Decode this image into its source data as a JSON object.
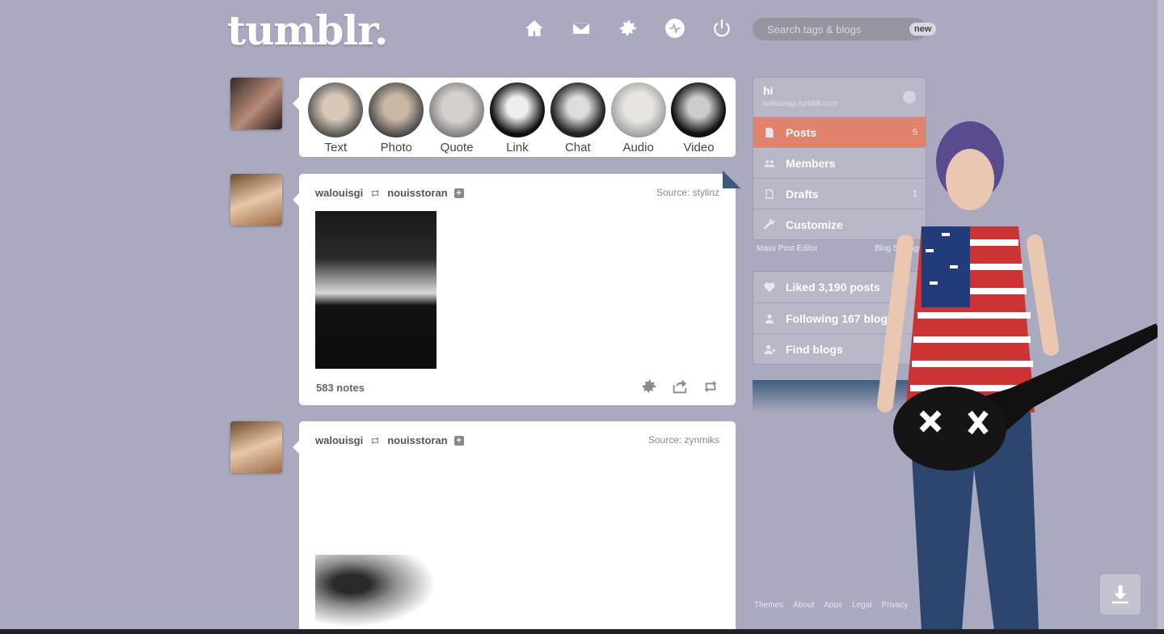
{
  "header": {
    "logo": "tumblr.",
    "nav": [
      "home-icon",
      "mail-icon",
      "gear-icon",
      "activity-icon",
      "power-icon"
    ],
    "search_placeholder": "Search tags & blogs",
    "search_badge": "new"
  },
  "post_types": [
    "Text",
    "Photo",
    "Quote",
    "Link",
    "Chat",
    "Audio",
    "Video"
  ],
  "posts": [
    {
      "user": "walouisgi",
      "reblogged_from": "nouisstoran",
      "source": "Source: stylinz",
      "notes": "583 notes"
    },
    {
      "user": "walouisgi",
      "reblogged_from": "nouisstoran",
      "source": "Source: zynmiks"
    }
  ],
  "sidebar": {
    "blog_title": "hi",
    "blog_url": "walouisgi.tumblr.com",
    "items": [
      {
        "label": "Posts",
        "count": "5",
        "icon": "posts-icon"
      },
      {
        "label": "Members",
        "count": "",
        "icon": "members-icon"
      },
      {
        "label": "Drafts",
        "count": "1",
        "icon": "drafts-icon"
      },
      {
        "label": "Customize",
        "count": "",
        "icon": "wrench-icon"
      }
    ],
    "sublinks": [
      "Mass Post Editor",
      "Blog Settings"
    ],
    "social": [
      {
        "label": "Liked 3,190 posts",
        "icon": "heart-icon"
      },
      {
        "label": "Following 167 blogs",
        "icon": "person-icon"
      },
      {
        "label": "Find blogs",
        "icon": "add-person-icon"
      }
    ]
  },
  "footer": [
    "Themes",
    "About",
    "Apps",
    "Legal",
    "Privacy"
  ],
  "colors": {
    "background": "#a9a9bf",
    "active_item": "#e0826c"
  }
}
